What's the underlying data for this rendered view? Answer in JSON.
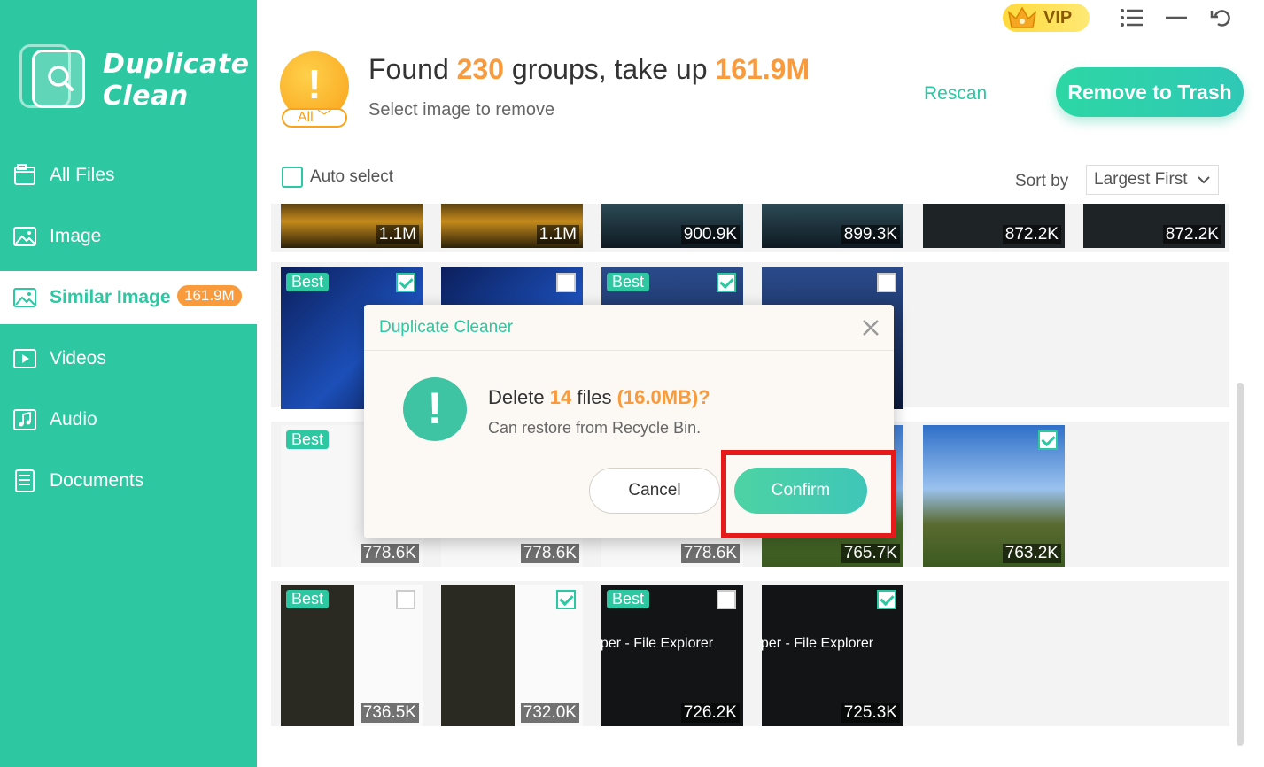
{
  "brand": {
    "line1": "Duplicate",
    "line2": "Clean"
  },
  "sidebar": {
    "items": [
      {
        "label": "All Files",
        "icon": "folder-icon"
      },
      {
        "label": "Image",
        "icon": "image-icon"
      },
      {
        "label": "Similar Image",
        "icon": "similar-image-icon",
        "badge": "161.9M",
        "active": true
      },
      {
        "label": "Videos",
        "icon": "video-icon"
      },
      {
        "label": "Audio",
        "icon": "audio-icon"
      },
      {
        "label": "Documents",
        "icon": "document-icon"
      }
    ]
  },
  "header": {
    "found_prefix": "Found",
    "group_count": "230",
    "mid": "groups, take up",
    "total_size": "161.9M",
    "subtitle": "Select image to remove",
    "filter_value": "All",
    "rescan": "Rescan",
    "remove_button": "Remove to Trash",
    "vip": "VIP"
  },
  "toolbar": {
    "auto_select": "Auto select",
    "sort_label": "Sort by",
    "sort_value": "Largest First"
  },
  "groups": [
    {
      "thumbs": [
        {
          "size": "1.1M"
        },
        {
          "size": "1.1M"
        },
        {
          "size": "900.9K"
        },
        {
          "size": "899.3K"
        },
        {
          "size": "872.2K"
        },
        {
          "size": "872.2K"
        }
      ]
    },
    {
      "thumbs": [
        {
          "best": "Best",
          "checked": true
        },
        {
          "checked": false
        },
        {
          "best": "Best",
          "checked": true
        },
        {
          "checked": false
        }
      ]
    },
    {
      "thumbs": [
        {
          "best": "Best",
          "size": "778.6K"
        },
        {
          "size": "778.6K"
        },
        {
          "size": "778.6K"
        },
        {
          "size": "765.7K"
        },
        {
          "size": "763.2K",
          "checked": true
        }
      ]
    },
    {
      "thumbs": [
        {
          "best": "Best",
          "size": "736.5K",
          "checked": false
        },
        {
          "size": "732.0K",
          "checked": true
        },
        {
          "best": "Best",
          "size": "726.2K",
          "checked": false,
          "text": "oper - File Explorer"
        },
        {
          "size": "725.3K",
          "checked": true,
          "text": "oper - File Explorer"
        }
      ]
    }
  ],
  "dialog": {
    "title": "Duplicate Cleaner",
    "q_prefix": "Delete",
    "file_count": "14",
    "q_mid": "files",
    "file_size": "(16.0MB)?",
    "subtitle": "Can restore from Recycle Bin.",
    "cancel": "Cancel",
    "confirm": "Confirm"
  },
  "colors": {
    "accent": "#2dc7a1",
    "orange": "#f99a3c",
    "highlight": "#e51b1b"
  }
}
